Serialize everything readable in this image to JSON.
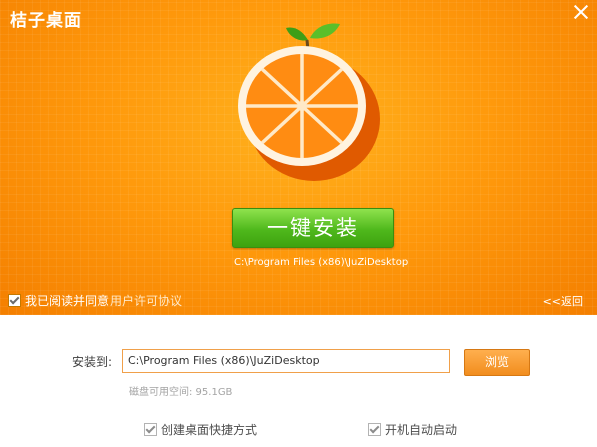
{
  "app": {
    "title": "桔子桌面"
  },
  "hero": {
    "install_label": "一键安装",
    "install_path": "C:\\Program Files (x86)\\JuZiDesktop",
    "agree_text": "我已阅读并同意",
    "agree_link": "用户许可协议",
    "back_label": "<<返回"
  },
  "form": {
    "install_to_label": "安装到:",
    "path_value": "C:\\Program Files (x86)\\JuZiDesktop",
    "browse_label": "浏览",
    "disk_space": "磁盘可用空间: 95.1GB"
  },
  "options": {
    "desktop_shortcut": "创建桌面快捷方式",
    "autostart": "开机自动启动"
  },
  "colors": {
    "hero": "#ff9a0c",
    "install_button": "#4fb81c",
    "browse_button": "#f18d1e"
  }
}
